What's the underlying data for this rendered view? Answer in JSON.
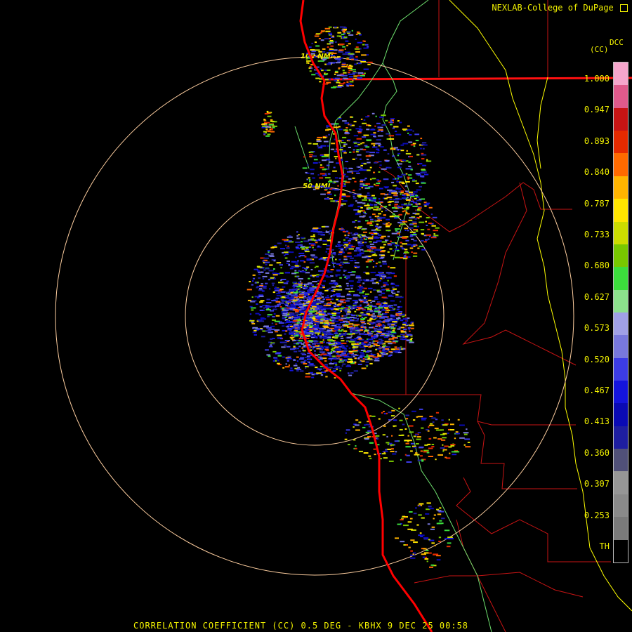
{
  "header": {
    "credit": "NEXLAB-College of DuPage"
  },
  "footer": {
    "product_line": "CORRELATION COEFFICIENT (CC) 0.5 DEG - KBHX 9 DEC 25 00:58"
  },
  "legend": {
    "unit_label": "(CC)",
    "product_code": "DCC",
    "ticks": [
      "1.000",
      "0.947",
      "0.893",
      "0.840",
      "0.787",
      "0.733",
      "0.680",
      "0.627",
      "0.573",
      "0.520",
      "0.467",
      "0.413",
      "0.360",
      "0.307",
      "0.253",
      "TH"
    ],
    "colors": [
      "#f6a6cc",
      "#e05a8c",
      "#c81414",
      "#e62a00",
      "#ff6a00",
      "#ffb400",
      "#ffe600",
      "#ccdc00",
      "#78c800",
      "#3cdc3c",
      "#8ce08c",
      "#a0a0e6",
      "#7878dc",
      "#3c3ce6",
      "#1414dc",
      "#0a0ab4",
      "#1e1ea0",
      "#505078",
      "#969696",
      "#8a8a8a",
      "#7a7a7a",
      "#000000"
    ]
  },
  "map": {
    "range_rings": [
      "100 NMI",
      "50 NMI"
    ],
    "colors": {
      "coastline": "#ff0000",
      "state_line": "#ff1010",
      "county_line": "#c81414",
      "highway": "#ffff00",
      "river": "#6ee06e",
      "range_ring": "#ffcfa0"
    }
  }
}
